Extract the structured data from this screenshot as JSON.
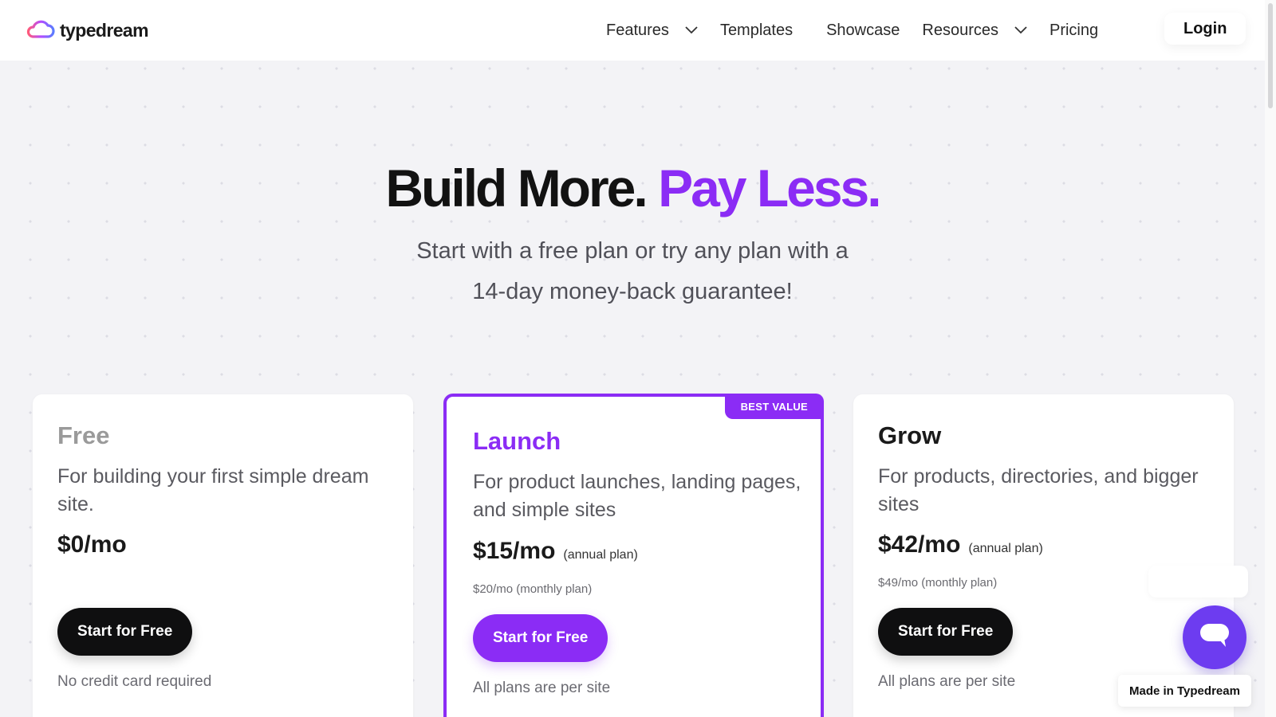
{
  "brand": {
    "name": "typedream"
  },
  "nav": {
    "features": "Features",
    "templates": "Templates",
    "showcase": "Showcase",
    "resources": "Resources",
    "pricing": "Pricing",
    "login": "Login"
  },
  "hero": {
    "title_main": "Build More.",
    "title_accent": "Pay Less.",
    "subtitle_line1": "Start with a free plan or try any plan with a",
    "subtitle_line2": "14-day money-back guarantee!"
  },
  "plans": [
    {
      "name": "Free",
      "description": "For building your first simple dream site.",
      "price": "$0/mo",
      "price_note": "",
      "monthly": "",
      "cta": "Start for Free",
      "note": "No credit card required"
    },
    {
      "name": "Launch",
      "badge": "BEST VALUE",
      "description": "For product launches, landing pages, and simple sites",
      "price": "$15/mo",
      "price_note": "(annual plan)",
      "monthly": "$20/mo (monthly plan)",
      "cta": "Start for Free",
      "note": "All plans are per site"
    },
    {
      "name": "Grow",
      "description": "For products, directories, and bigger sites",
      "price": "$42/mo",
      "price_note": "(annual plan)",
      "monthly": "$49/mo (monthly plan)",
      "cta": "Start for Free",
      "note": "All plans are per site"
    }
  ],
  "widgets": {
    "made_in": "Made in Typedream",
    "chat_icon": "chat-icon"
  },
  "colors": {
    "accent": "#8b2cf5",
    "chat": "#6d3cf0",
    "dark_button": "#0f0f10"
  }
}
